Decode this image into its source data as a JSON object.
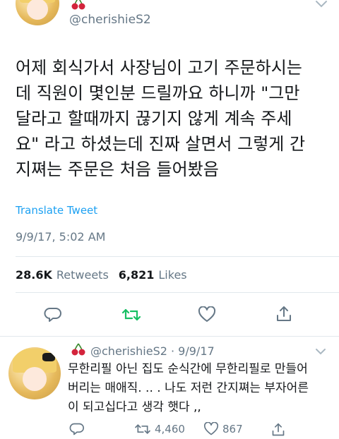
{
  "tweet": {
    "handle": "@cherishieS2",
    "text": "어제 회식가서 사장님이 고기 주문하시는\n데 직원이 몇인분 드릴까요 하니까 \"그만\n달라고 할때까지 끊기지 않게 계속 주세\n요\" 라고 하셨는데 진짜 살면서 그렇게 간\n지쪄는 주문은 처음 들어봤음",
    "translate_label": "Translate Tweet",
    "timestamp": "9/9/17, 5:02 AM",
    "retweets_count": "28.6K",
    "retweets_label": "Retweets",
    "likes_count": "6,821",
    "likes_label": "Likes"
  },
  "actions": {
    "reply_icon": "reply-icon",
    "retweet_icon": "retweet-icon",
    "like_icon": "heart-icon",
    "share_icon": "share-icon"
  },
  "reply": {
    "handle": "@cherishieS2",
    "separator": " · ",
    "date": "9/9/17",
    "text": "무한리필 아닌 집도 순식간에 무한리필로 만들어\n버리는 매애직. .. . 나도 저런 간지쪄는 부자어른\n이 되고십다고 생각 햇다 ,,",
    "retweets": "4,460",
    "likes": "867"
  },
  "colors": {
    "accent": "#1da1f2",
    "retweet_green": "#17bf63",
    "muted": "#657786",
    "text": "#14171a",
    "cherry_red": "#d3243c",
    "cherry_stem": "#3b8a2e"
  }
}
